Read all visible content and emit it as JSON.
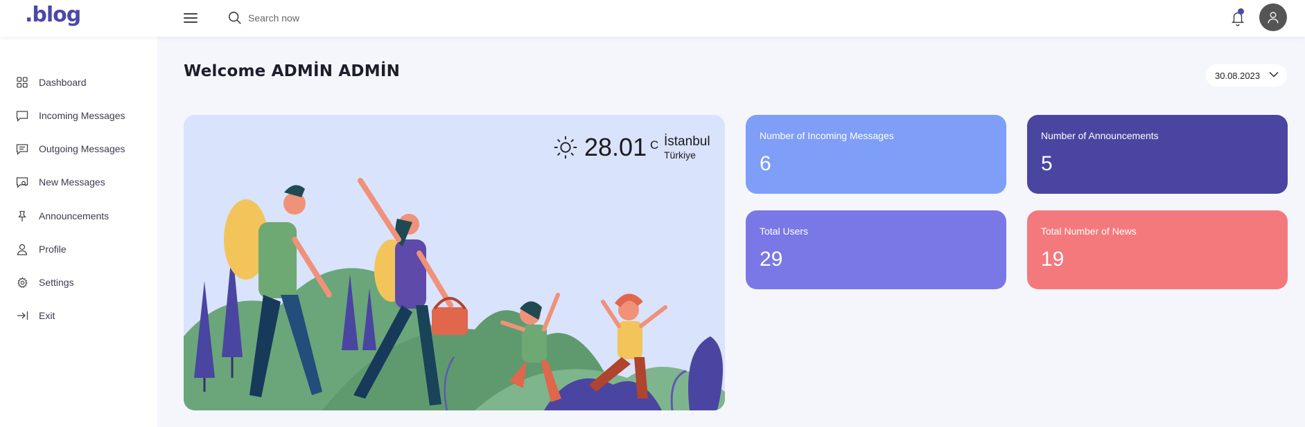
{
  "brand": {
    "logo_text": "blog",
    "logo_dot": "."
  },
  "header": {
    "search_placeholder": "Search now",
    "icons": [
      "menu-icon",
      "search-icon",
      "bell-icon",
      "user-icon"
    ]
  },
  "sidebar": {
    "items": [
      {
        "label": "Dashboard",
        "icon": "grid-icon"
      },
      {
        "label": "Incoming Messages",
        "icon": "message-icon"
      },
      {
        "label": "Outgoing Messages",
        "icon": "message-lines-icon"
      },
      {
        "label": "New Messages",
        "icon": "message-new-icon"
      },
      {
        "label": "Announcements",
        "icon": "pin-icon"
      },
      {
        "label": "Profile",
        "icon": "user-icon"
      },
      {
        "label": "Settings",
        "icon": "gear-icon"
      },
      {
        "label": "Exit",
        "icon": "logout-icon"
      }
    ]
  },
  "main": {
    "welcome": "Welcome ADMİN ADMİN",
    "date": "30.08.2023",
    "weather": {
      "temp": "28.01",
      "unit": "C",
      "city": "İstanbul",
      "country": "Türkiye",
      "icon": "sun-icon"
    },
    "cards": [
      {
        "title": "Number of Incoming Messages",
        "value": "6",
        "color": "#7e9ef7"
      },
      {
        "title": "Number of Announcements",
        "value": "5",
        "color": "#4a45a0"
      },
      {
        "title": "Total Users",
        "value": "29",
        "color": "#7a78e6"
      },
      {
        "title": "Total Number of News",
        "value": "19",
        "color": "#f4797d"
      }
    ]
  },
  "colors": {
    "accent": "#4a48a8",
    "background": "#f4f6fc",
    "hero_bg": "#d9e3fb"
  }
}
